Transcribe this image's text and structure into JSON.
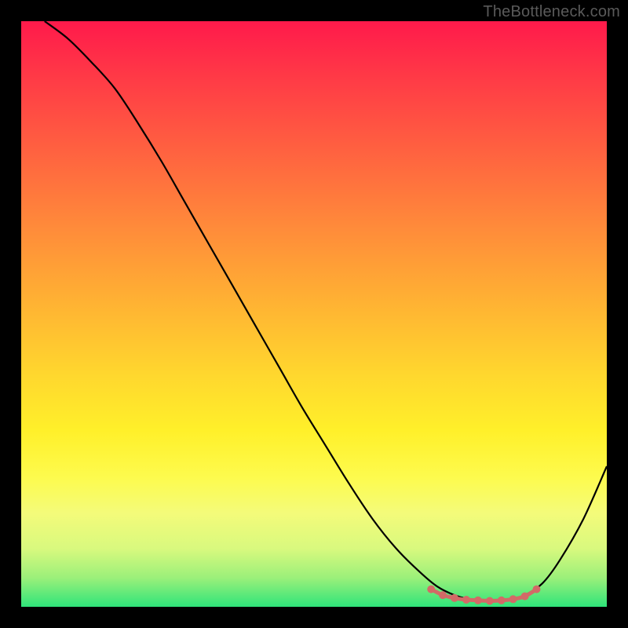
{
  "watermark": "TheBottleneck.com",
  "chart_data": {
    "type": "line",
    "title": "",
    "xlabel": "",
    "ylabel": "",
    "xlim": [
      0,
      100
    ],
    "ylim": [
      0,
      100
    ],
    "grid": false,
    "series": [
      {
        "name": "curve",
        "color": "#000000",
        "x": [
          4,
          8,
          12,
          16,
          20,
          24,
          28,
          32,
          36,
          40,
          44,
          48,
          52,
          56,
          60,
          64,
          68,
          71,
          74,
          77,
          80,
          83,
          86,
          89,
          92,
          96,
          100
        ],
        "y": [
          100,
          97,
          93,
          88.5,
          82.5,
          76,
          69,
          62,
          55,
          48,
          41,
          34,
          27.5,
          21,
          15,
          10,
          6,
          3.5,
          2,
          1.2,
          1,
          1.2,
          2,
          4,
          8,
          15,
          24
        ]
      },
      {
        "name": "optimum-band",
        "color": "#d36a67",
        "marker": "dot",
        "x": [
          70,
          72,
          74,
          76,
          78,
          80,
          82,
          84,
          86,
          88
        ],
        "y": [
          3.0,
          2.0,
          1.5,
          1.2,
          1.1,
          1.0,
          1.1,
          1.3,
          1.8,
          3.0
        ]
      }
    ],
    "background_gradient": {
      "orientation": "vertical",
      "stops": [
        {
          "pos": 0.0,
          "color": "#ff1a4b"
        },
        {
          "pos": 0.5,
          "color": "#ffc531"
        },
        {
          "pos": 0.8,
          "color": "#fdfb4e"
        },
        {
          "pos": 1.0,
          "color": "#2fe47a"
        }
      ]
    }
  }
}
